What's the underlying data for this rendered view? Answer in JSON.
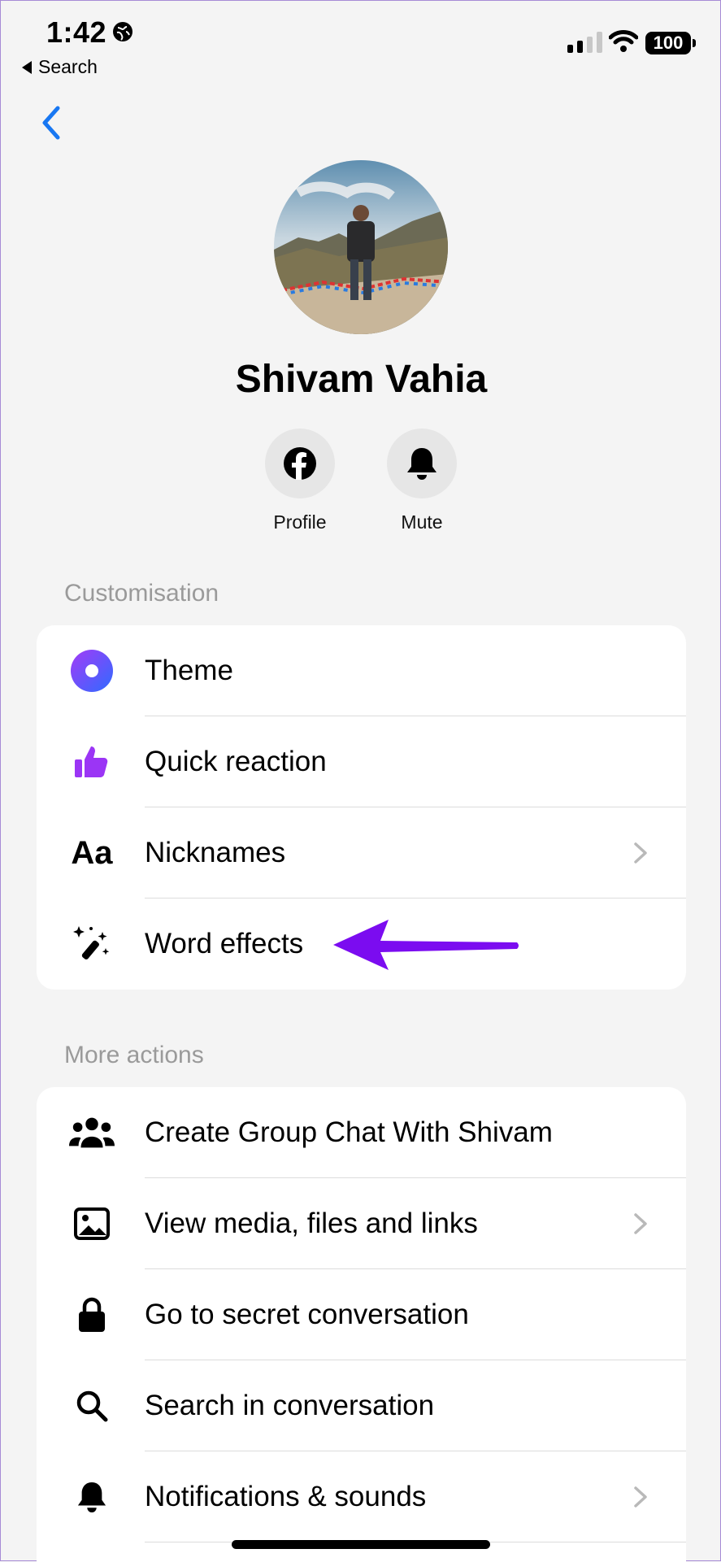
{
  "status_bar": {
    "time": "1:42",
    "back_app_label": "Search",
    "battery": "100",
    "icons": [
      "globe-icon",
      "signal-icon",
      "wifi-icon",
      "battery-icon"
    ]
  },
  "nav": {
    "back_icon": "chevron-left-icon"
  },
  "profile": {
    "name": "Shivam Vahia",
    "avatar": "profile-photo",
    "actions": [
      {
        "label": "Profile",
        "icon": "facebook-icon"
      },
      {
        "label": "Mute",
        "icon": "bell-icon"
      }
    ]
  },
  "customisation": {
    "title": "Customisation",
    "items": [
      {
        "label": "Theme",
        "icon": "theme-dot-icon",
        "chevron": false
      },
      {
        "label": "Quick reaction",
        "icon": "thumbs-up-icon",
        "chevron": false
      },
      {
        "label": "Nicknames",
        "icon": "text-aa-icon",
        "chevron": true
      },
      {
        "label": "Word effects",
        "icon": "magic-wand-icon",
        "chevron": false
      }
    ]
  },
  "more_actions": {
    "title": "More actions",
    "items": [
      {
        "label": "Create Group Chat With Shivam",
        "icon": "group-icon",
        "chevron": false
      },
      {
        "label": "View media, files and links",
        "icon": "image-icon",
        "chevron": true
      },
      {
        "label": "Go to secret conversation",
        "icon": "lock-icon",
        "chevron": false
      },
      {
        "label": "Search in conversation",
        "icon": "search-icon",
        "chevron": false
      },
      {
        "label": "Notifications & sounds",
        "icon": "bell-icon",
        "chevron": true
      }
    ]
  },
  "annotation": {
    "icon": "arrow-left-icon",
    "color": "#7b0cf0"
  },
  "colors": {
    "accent_blue": "#1877f2",
    "theme_gradient": [
      "#a33bf7",
      "#2f6bff"
    ],
    "reaction_purple": "#9b35f5",
    "background": "#f4f4f4"
  }
}
